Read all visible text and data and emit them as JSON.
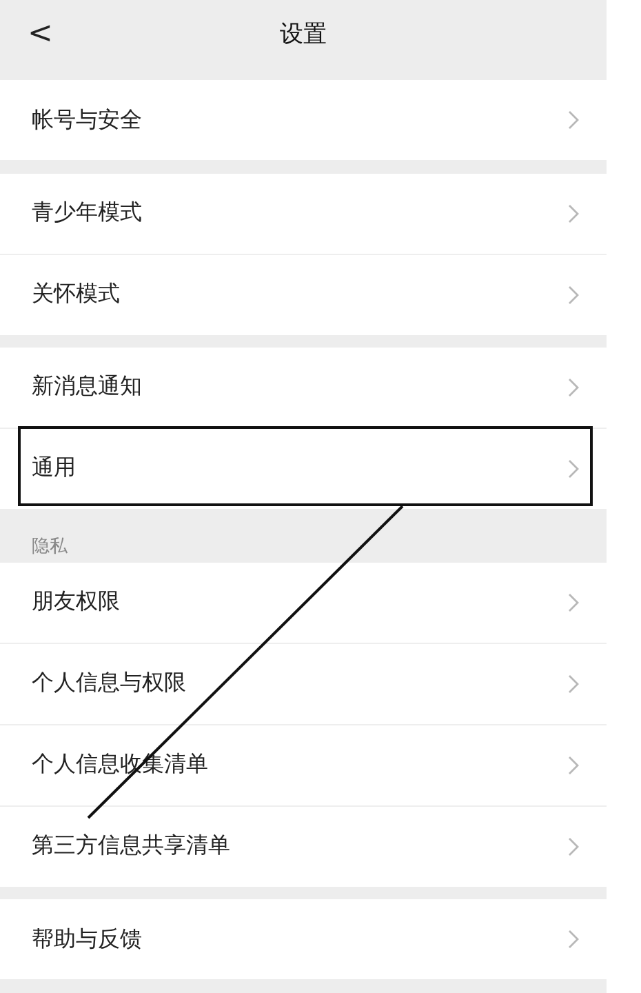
{
  "header": {
    "back": "<",
    "title": "设置"
  },
  "groups": [
    {
      "items": [
        {
          "label": "帐号与安全",
          "highlighted": false
        }
      ]
    },
    {
      "items": [
        {
          "label": "青少年模式",
          "highlighted": false
        },
        {
          "label": "关怀模式",
          "highlighted": false
        }
      ]
    },
    {
      "items": [
        {
          "label": "新消息通知",
          "highlighted": false
        },
        {
          "label": "通用",
          "highlighted": true
        }
      ]
    },
    {
      "title": "隐私",
      "items": [
        {
          "label": "朋友权限",
          "highlighted": false
        },
        {
          "label": "个人信息与权限",
          "highlighted": false
        },
        {
          "label": "个人信息收集清单",
          "highlighted": false
        },
        {
          "label": "第三方信息共享清单",
          "highlighted": false
        }
      ]
    },
    {
      "items": [
        {
          "label": "帮助与反馈",
          "highlighted": false
        }
      ]
    }
  ]
}
